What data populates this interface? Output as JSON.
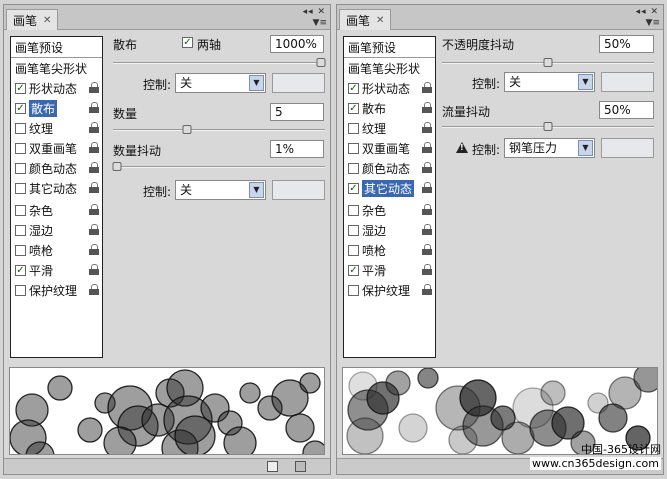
{
  "watermark": {
    "line1": "中国-365设计网",
    "line2": "www.cn365design.com"
  },
  "left": {
    "tab": "画笔",
    "close": "✕",
    "list_header": "画笔预设",
    "list_tip": "画笔笔尖形状",
    "items": [
      {
        "label": "形状动态",
        "checked": true,
        "selected": false
      },
      {
        "label": "散布",
        "checked": true,
        "selected": true
      },
      {
        "label": "纹理",
        "checked": false,
        "selected": false
      },
      {
        "label": "双重画笔",
        "checked": false,
        "selected": false
      },
      {
        "label": "颜色动态",
        "checked": false,
        "selected": false
      },
      {
        "label": "其它动态",
        "checked": false,
        "selected": false
      },
      {
        "label": "杂色",
        "checked": false,
        "selected": false
      },
      {
        "label": "湿边",
        "checked": false,
        "selected": false
      },
      {
        "label": "喷枪",
        "checked": false,
        "selected": false
      },
      {
        "label": "平滑",
        "checked": true,
        "selected": false
      },
      {
        "label": "保护纹理",
        "checked": false,
        "selected": false
      }
    ],
    "scatter_label": "散布",
    "both_axes_label": "两轴",
    "both_axes_checked": true,
    "scatter_value": "1000%",
    "scatter_level": 1.0,
    "control1_label": "控制:",
    "control1_value": "关",
    "count_label": "数量",
    "count_value": "5",
    "count_level": 0.35,
    "count_jitter_label": "数量抖动",
    "count_jitter_value": "1%",
    "count_jitter_level": 0.01,
    "control2_label": "控制:",
    "control2_value": "关"
  },
  "right": {
    "tab": "画笔",
    "close": "✕",
    "list_header": "画笔预设",
    "list_tip": "画笔笔尖形状",
    "items": [
      {
        "label": "形状动态",
        "checked": true,
        "selected": false
      },
      {
        "label": "散布",
        "checked": true,
        "selected": false
      },
      {
        "label": "纹理",
        "checked": false,
        "selected": false
      },
      {
        "label": "双重画笔",
        "checked": false,
        "selected": false
      },
      {
        "label": "颜色动态",
        "checked": false,
        "selected": false
      },
      {
        "label": "其它动态",
        "checked": true,
        "selected": true
      },
      {
        "label": "杂色",
        "checked": false,
        "selected": false
      },
      {
        "label": "湿边",
        "checked": false,
        "selected": false
      },
      {
        "label": "喷枪",
        "checked": false,
        "selected": false
      },
      {
        "label": "平滑",
        "checked": true,
        "selected": false
      },
      {
        "label": "保护纹理",
        "checked": false,
        "selected": false
      }
    ],
    "opacity_jitter_label": "不透明度抖动",
    "opacity_jitter_value": "50%",
    "opacity_jitter_level": 0.5,
    "control1_label": "控制:",
    "control1_value": "关",
    "flow_jitter_label": "流量抖动",
    "flow_jitter_value": "50%",
    "flow_jitter_level": 0.5,
    "control2_label": "控制:",
    "control2_value": "钢笔压力"
  }
}
